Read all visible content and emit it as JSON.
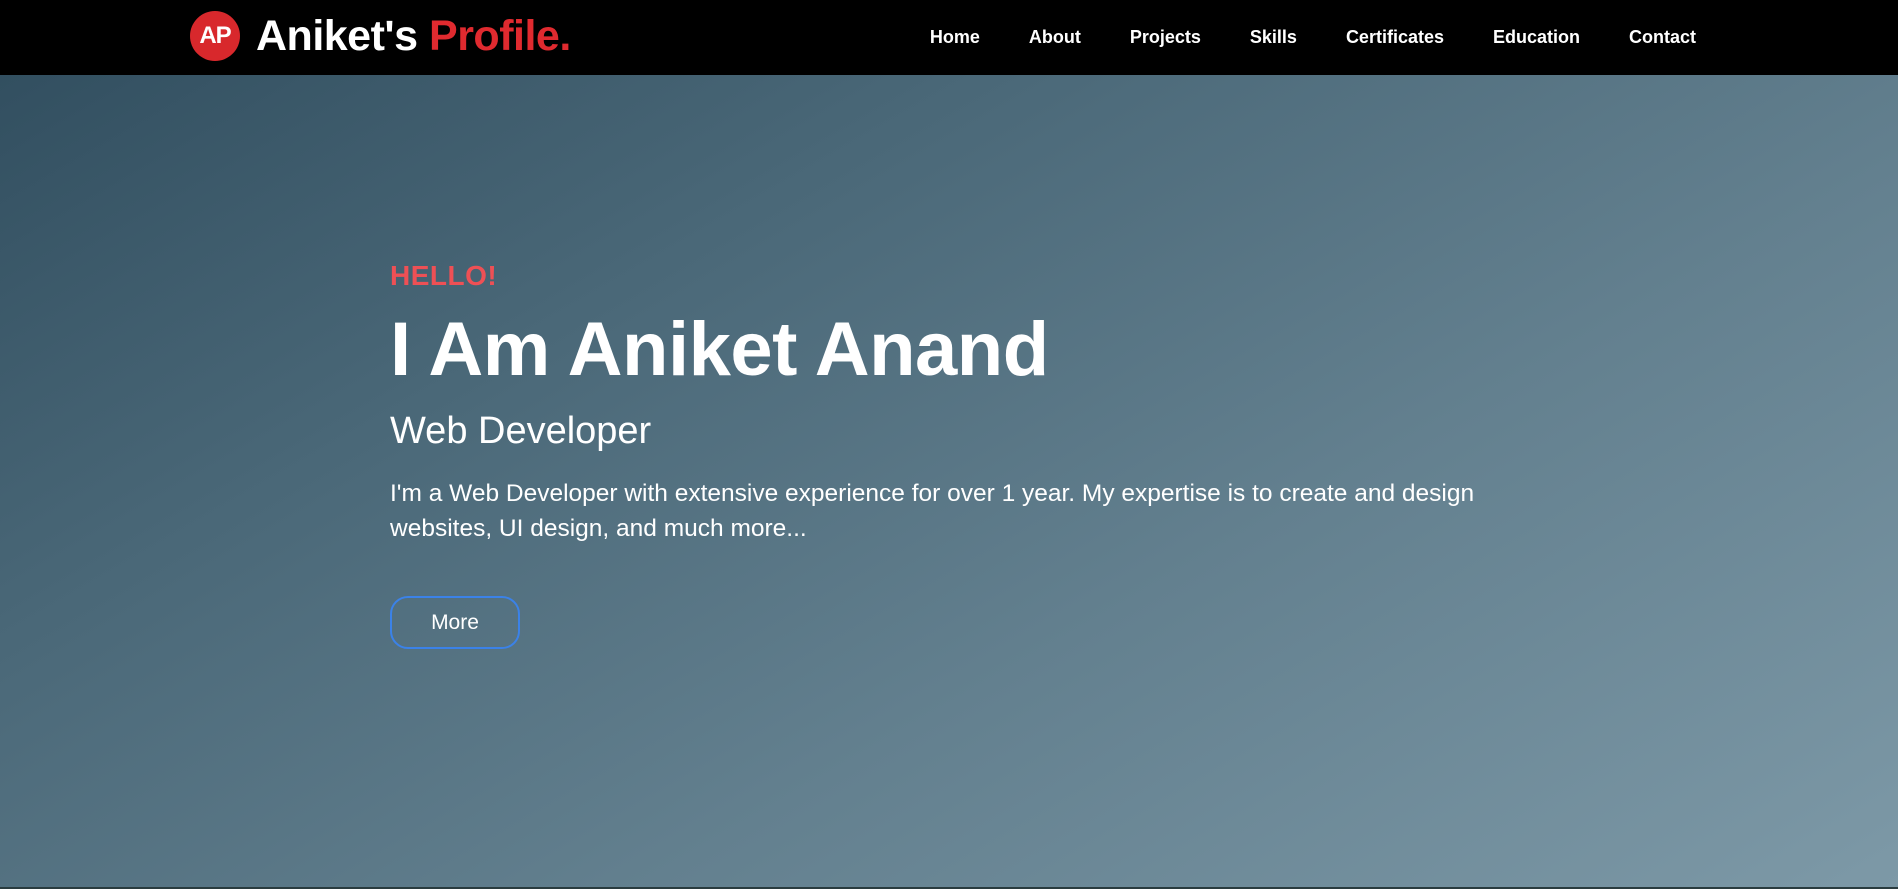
{
  "navbar": {
    "logo_badge": "AP",
    "brand_main": "Aniket's ",
    "brand_accent": "Profile.",
    "links": [
      "Home",
      "About",
      "Projects",
      "Skills",
      "Certificates",
      "Education",
      "Contact"
    ]
  },
  "hero": {
    "greeting": "HELLO!",
    "name": "I Am Aniket Anand",
    "role": "Web Developer",
    "description": "I'm a Web Developer with extensive experience for over 1 year. My expertise is to create and design websites, UI design, and much more...",
    "button_label": "More"
  },
  "colors": {
    "navbar_bg": "#000000",
    "brand_accent": "#e02a2f",
    "greeting": "#ee5055",
    "button_border": "#3b82e8"
  }
}
